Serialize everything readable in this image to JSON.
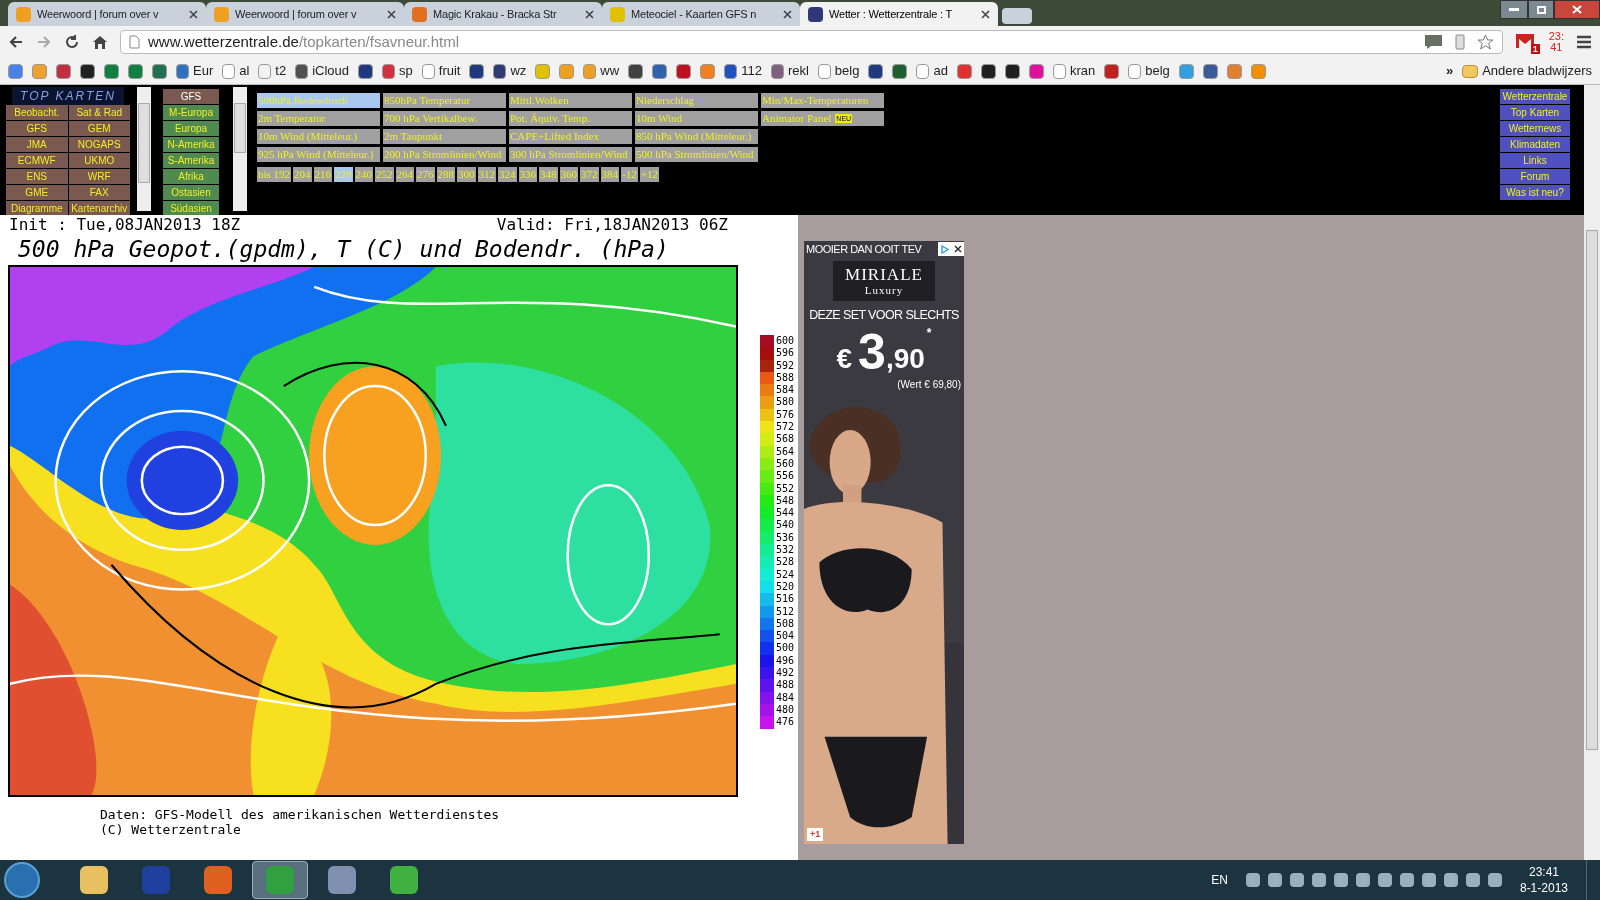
{
  "browser": {
    "tabs": [
      {
        "title": "Weerwoord | forum over v",
        "color": "#f0a020",
        "selected": false
      },
      {
        "title": "Weerwoord | forum over v",
        "color": "#f0a020",
        "selected": false
      },
      {
        "title": "Magic Krakau - Bracka Str",
        "color": "#e07020",
        "selected": false
      },
      {
        "title": "Meteociel - Kaarten GFS n",
        "color": "#e0c000",
        "selected": false
      },
      {
        "title": "Wetter : Wetterzentrale : T",
        "color": "#303878",
        "selected": true
      }
    ],
    "address": {
      "host": "www.wetterzentrale.de",
      "path": "/topkarten/fsavneur.html"
    },
    "mail_badge": "1",
    "clock": [
      "23:",
      "41"
    ],
    "bookmarks": [
      {
        "color": "#4a80e8"
      },
      {
        "color": "#f0a030"
      },
      {
        "color": "#c03040"
      },
      {
        "color": "#202020"
      },
      {
        "color": "#108040"
      },
      {
        "color": "#108040"
      },
      {
        "color": "#207050"
      },
      {
        "label": "Eur",
        "color": "#3070c0"
      },
      {
        "label": "al",
        "color": "#ffffff"
      },
      {
        "label": "t2",
        "color": "#f2f2f2"
      },
      {
        "label": "iCloud",
        "color": "#505050"
      },
      {
        "color": "#203880"
      },
      {
        "label": "sp",
        "color": "#d03040"
      },
      {
        "label": "fruit",
        "color": "#ffffff"
      },
      {
        "color": "#203880"
      },
      {
        "label": "wz",
        "color": "#303878"
      },
      {
        "color": "#e0c000"
      },
      {
        "color": "#f0a020"
      },
      {
        "label": "ww",
        "color": "#f0a020"
      },
      {
        "color": "#404040"
      },
      {
        "color": "#3060b0"
      },
      {
        "color": "#c01020"
      },
      {
        "color": "#f08020"
      },
      {
        "label": "112",
        "color": "#2050c0"
      },
      {
        "label": "rekl",
        "color": "#806080"
      },
      {
        "label": "belg",
        "color": "#ffffff"
      },
      {
        "color": "#203880"
      },
      {
        "color": "#206030"
      },
      {
        "label": "ad",
        "color": "#ffffff"
      },
      {
        "color": "#e03030"
      },
      {
        "color": "#202020"
      },
      {
        "color": "#202020"
      },
      {
        "color": "#e0109a"
      },
      {
        "label": "kran",
        "color": "#ffffff"
      },
      {
        "color": "#c02020"
      },
      {
        "label": "belg",
        "color": "#ffffff"
      },
      {
        "color": "#30a0e0"
      },
      {
        "color": "#3b5998"
      },
      {
        "color": "#e08030"
      },
      {
        "color": "#f09000"
      }
    ],
    "more": "»",
    "other_bookmarks": "Andere bladwijzers"
  },
  "nav": {
    "logo": "TOP KARTEN",
    "models": [
      {
        "label": "Beobacht."
      },
      {
        "label": "Sat & Rad"
      },
      {
        "label": "GFS"
      },
      {
        "label": "GEM"
      },
      {
        "label": "JMA"
      },
      {
        "label": "NOGAPS"
      },
      {
        "label": "ECMWF"
      },
      {
        "label": "UKMO"
      },
      {
        "label": "ENS"
      },
      {
        "label": "WRF"
      },
      {
        "label": "GME"
      },
      {
        "label": "FAX"
      },
      {
        "label": "Diagramme"
      },
      {
        "label": "Kartenarchiv"
      }
    ],
    "regions_header": "GFS",
    "regions": [
      {
        "label": "M-Europa"
      },
      {
        "label": "Europa"
      },
      {
        "label": "N-Amerika"
      },
      {
        "label": "S-Amerika"
      },
      {
        "label": "Afrika"
      },
      {
        "label": "Ostasien"
      },
      {
        "label": "Südasien"
      }
    ],
    "map_rows": [
      [
        {
          "label": "500hPa,Bodendruck",
          "selected": true
        },
        {
          "label": "850hPa Temperatur",
          "selected": false
        },
        {
          "label": "Mittl.Wolken",
          "selected": false
        },
        {
          "label": "Niederschlag",
          "selected": false
        },
        {
          "label": "Min/Max-Temperaturen",
          "selected": false
        }
      ],
      [
        {
          "label": "2m Temperatur",
          "selected": false
        },
        {
          "label": "700 hPa Vertikalbew.",
          "selected": false
        },
        {
          "label": "Pot. Äquiv. Temp.",
          "selected": false
        },
        {
          "label": "10m Wind",
          "selected": false
        },
        {
          "label": "Animator Panel",
          "selected": false,
          "badge": "NEU"
        }
      ],
      [
        {
          "label": "10m Wind (Mitteleur.)",
          "selected": false
        },
        {
          "label": "2m Taupunkt",
          "selected": false
        },
        {
          "label": "CAPE+Lifted Index",
          "selected": false
        },
        {
          "label": "850 hPa Wind (Mitteleur.)",
          "selected": false
        }
      ],
      [
        {
          "label": "925 hPa Wind (Mitteleur.)",
          "selected": false
        },
        {
          "label": "200 hPa Stromlinien/Wind",
          "selected": false
        },
        {
          "label": "300 hPa Stromlinien/Wind",
          "selected": false
        },
        {
          "label": "500 hPa Stromlinien/Wind",
          "selected": false
        }
      ]
    ],
    "hours": [
      {
        "label": "bis 192",
        "selected": false
      },
      {
        "label": "204",
        "selected": false
      },
      {
        "label": "216",
        "selected": false
      },
      {
        "label": "228",
        "selected": true
      },
      {
        "label": "240",
        "selected": false
      },
      {
        "label": "252",
        "selected": false
      },
      {
        "label": "264",
        "selected": false
      },
      {
        "label": "276",
        "selected": false
      },
      {
        "label": "288",
        "selected": false
      },
      {
        "label": "300",
        "selected": false
      },
      {
        "label": "312",
        "selected": false
      },
      {
        "label": "324",
        "selected": false
      },
      {
        "label": "336",
        "selected": false
      },
      {
        "label": "348",
        "selected": false
      },
      {
        "label": "360",
        "selected": false
      },
      {
        "label": "372",
        "selected": false
      },
      {
        "label": "384",
        "selected": false
      },
      {
        "label": "-12",
        "selected": false
      },
      {
        "label": "+12",
        "selected": false
      }
    ],
    "site": [
      {
        "label": "Wetterzentrale"
      },
      {
        "label": "Top Karten"
      },
      {
        "label": "Wetternews"
      },
      {
        "label": "Klimadaten"
      },
      {
        "label": "Links"
      },
      {
        "label": "Forum"
      },
      {
        "label": "Was ist neu?"
      }
    ]
  },
  "map": {
    "init": "Init : Tue,08JAN2013 18Z",
    "valid": "Valid: Fri,18JAN2013 06Z",
    "title": "500 hPa Geopot.(gpdm), T (C) und Bodendr. (hPa)",
    "legend": [
      "600",
      "596",
      "592",
      "588",
      "584",
      "580",
      "576",
      "572",
      "568",
      "564",
      "560",
      "556",
      "552",
      "548",
      "544",
      "540",
      "536",
      "532",
      "528",
      "524",
      "520",
      "516",
      "512",
      "508",
      "504",
      "500",
      "496",
      "492",
      "488",
      "484",
      "480",
      "476"
    ],
    "credits": [
      "Daten: GFS-Modell des amerikanischen Wetterdienstes",
      "(C) Wetterzentrale"
    ]
  },
  "ad": {
    "header": "MOOIER DAN OOIT TEV",
    "brand": "MIRIALE",
    "brand_sub": "Luxury",
    "headline": "DEZE SET VOOR SLECHTS",
    "currency": "€",
    "price_main": "3",
    "price_cents": ",90",
    "asterisk": "*",
    "was": "(Wert € 69,80)",
    "plus": "+1"
  },
  "taskbar": {
    "apps": [
      {
        "color": "#e8c060",
        "selected": false
      },
      {
        "color": "#2040a0",
        "selected": false
      },
      {
        "color": "#e06020",
        "selected": false
      },
      {
        "color": "#30a040",
        "selected": true
      },
      {
        "color": "#8090b0",
        "selected": false
      },
      {
        "color": "#40b040",
        "selected": false
      }
    ],
    "language": "EN",
    "time": "23:41",
    "date": "8-1-2013"
  }
}
